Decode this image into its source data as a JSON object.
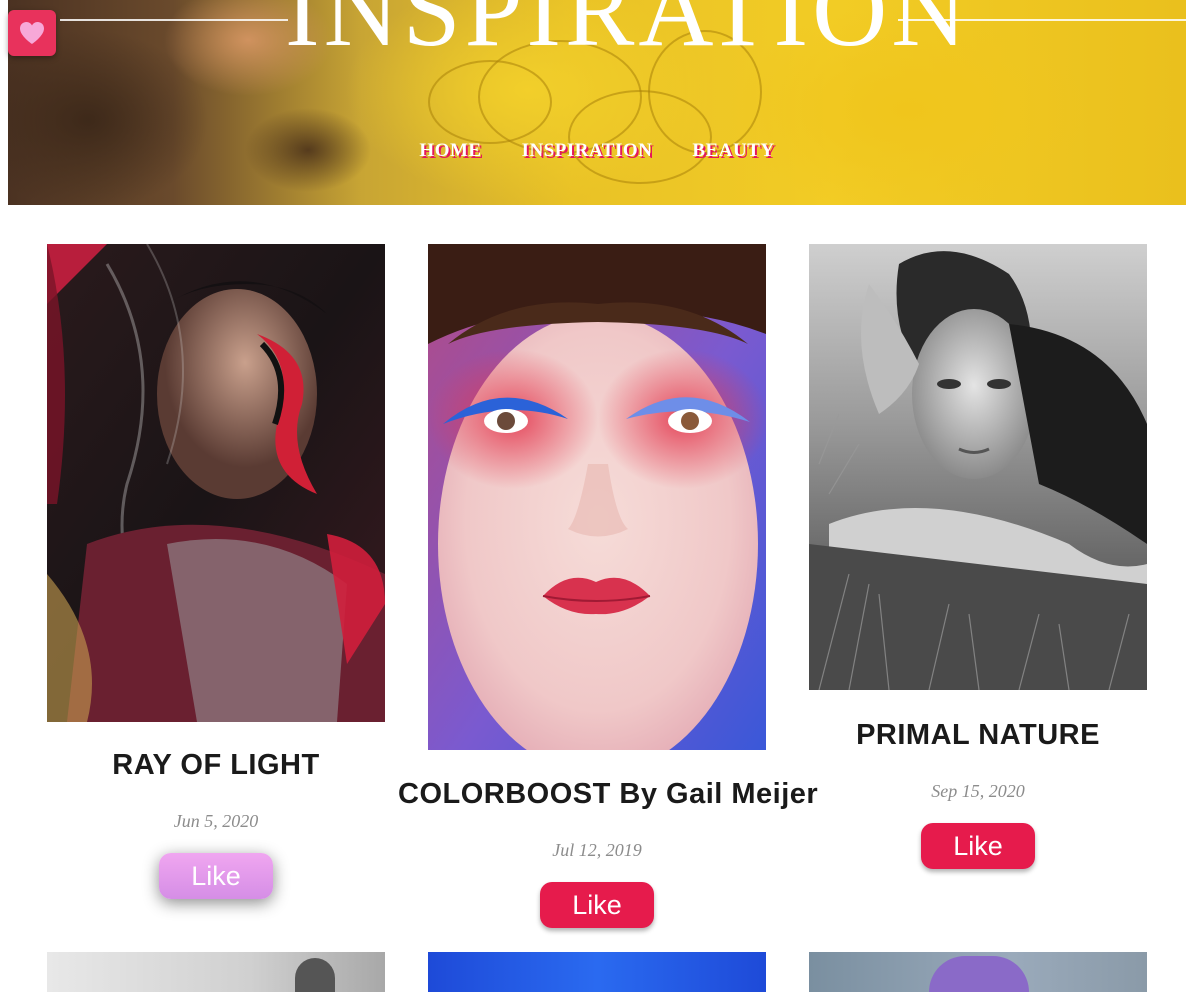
{
  "site": {
    "title": "INSPIRATION"
  },
  "nav": [
    {
      "label": "HOME"
    },
    {
      "label": "INSPIRATION"
    },
    {
      "label": "BEAUTY"
    }
  ],
  "favorite_button": {
    "icon": "heart-icon",
    "color": "#e8325c"
  },
  "posts": [
    {
      "title": "RAY OF LIGHT",
      "date": "Jun 5, 2020",
      "like_label": "Like",
      "liked": true
    },
    {
      "title": "COLORBOOST By Gail Meijer",
      "date": "Jul 12, 2019",
      "like_label": "Like",
      "liked": false
    },
    {
      "title": "PRIMAL NATURE",
      "date": "Sep 15, 2020",
      "like_label": "Like",
      "liked": false
    }
  ],
  "colors": {
    "like": "#e61b4c",
    "like_active": "#d58ee6",
    "nav_shadow": "#e4175a",
    "hero_yellow": "#f2cc25"
  }
}
